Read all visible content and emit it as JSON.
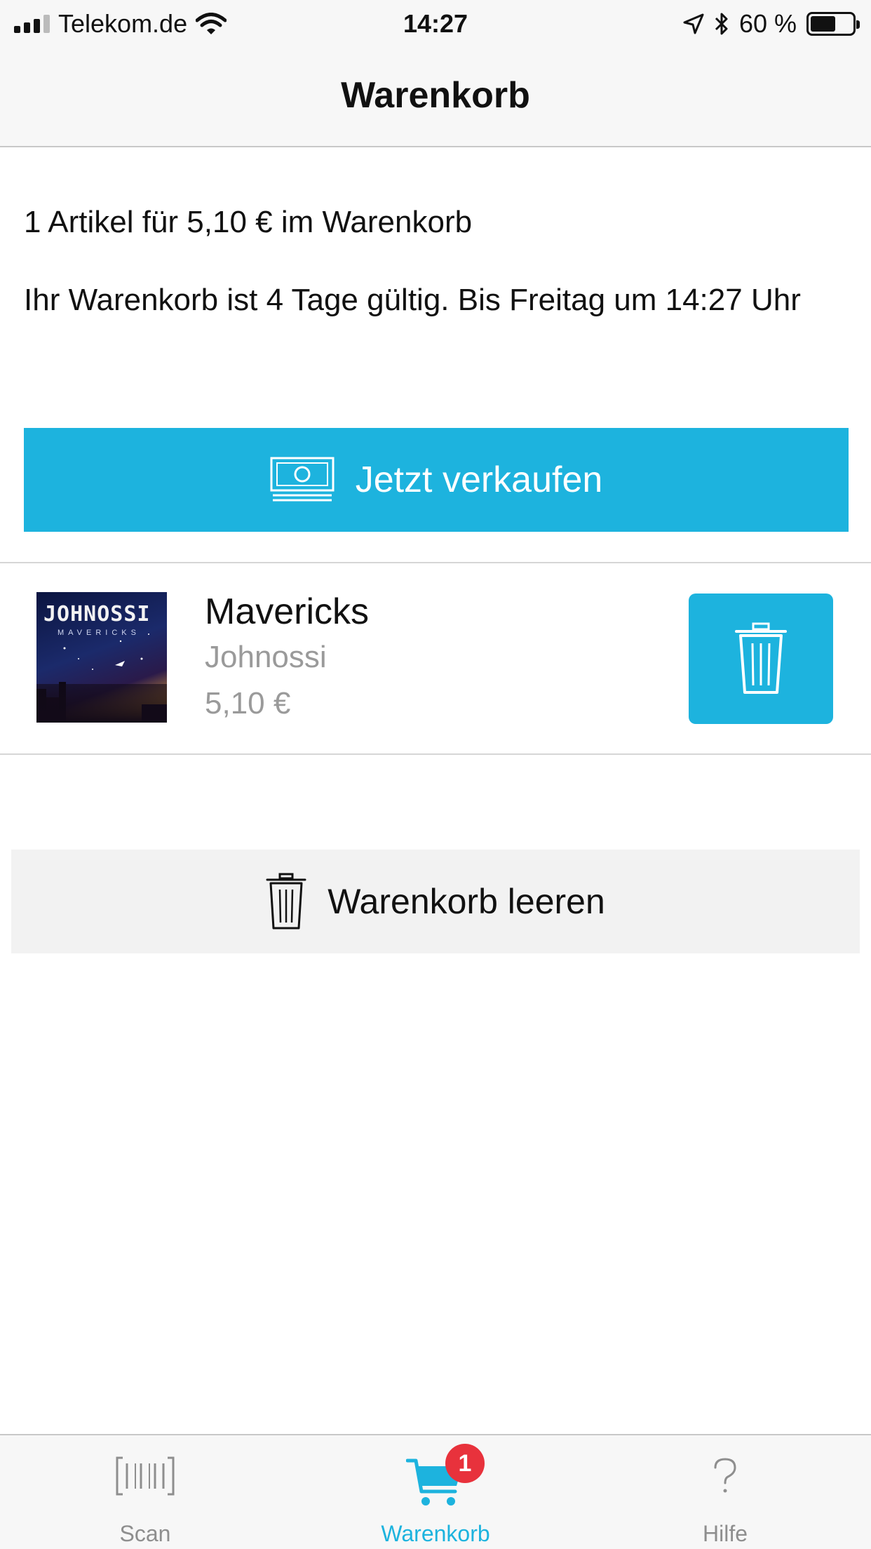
{
  "status_bar": {
    "carrier": "Telekom.de",
    "time": "14:27",
    "battery_percent": "60 %",
    "battery_level": 0.6
  },
  "nav": {
    "title": "Warenkorb"
  },
  "summary": {
    "count_text": "1 Artikel für 5,10 € im Warenkorb",
    "validity_text": "Ihr Warenkorb ist 4 Tage gültig. Bis Freitag um 14:27 Uhr"
  },
  "sell_button": {
    "label": "Jetzt verkaufen",
    "icon": "banknote-icon"
  },
  "cart_items": [
    {
      "title": "Mavericks",
      "artist": "Johnossi",
      "price": "5,10 €",
      "cover_band_text": "JOHNOSSI",
      "cover_title_text": "MAVERICKS",
      "delete_icon": "trash-icon"
    }
  ],
  "empty_cart_button": {
    "label": "Warenkorb leeren",
    "icon": "trash-icon"
  },
  "tab_bar": {
    "tabs": [
      {
        "label": "Scan",
        "icon": "barcode-icon",
        "active": false
      },
      {
        "label": "Warenkorb",
        "icon": "cart-icon",
        "active": true,
        "badge": "1"
      },
      {
        "label": "Hilfe",
        "icon": "question-icon",
        "active": false
      }
    ]
  },
  "colors": {
    "accent": "#1db3de",
    "badge": "#e8323c"
  }
}
